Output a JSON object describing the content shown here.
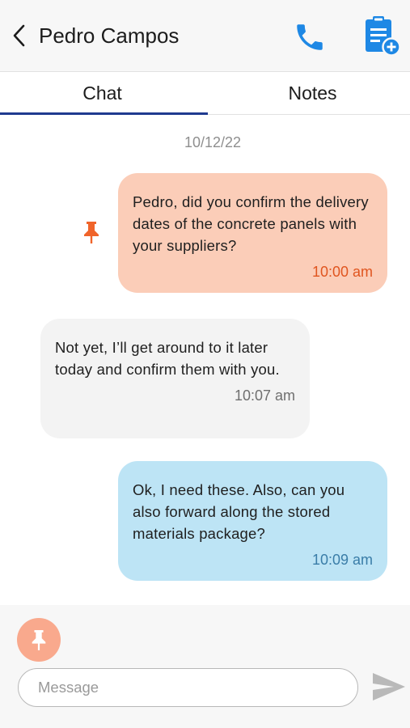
{
  "header": {
    "contact_name": "Pedro Campos",
    "icons": {
      "back": "chevron-left-icon",
      "call": "phone-icon",
      "add_note": "clipboard-add-icon"
    }
  },
  "tabs": [
    {
      "label": "Chat",
      "active": true
    },
    {
      "label": "Notes",
      "active": false
    }
  ],
  "chat": {
    "date": "10/12/22",
    "messages": [
      {
        "direction": "outgoing",
        "pinned": true,
        "text": "Pedro, did you confirm the delivery dates of the concrete panels with your suppliers?",
        "time": "10:00 am"
      },
      {
        "direction": "incoming",
        "pinned": false,
        "text": "Not yet, I’ll get around to it later today and confirm them with you.",
        "time": "10:07 am"
      },
      {
        "direction": "outgoing",
        "pinned": false,
        "text": "Ok, I need these. Also, can you also forward along the stored materials package?",
        "time": "10:09 am"
      }
    ]
  },
  "composer": {
    "placeholder": "Message",
    "value": "",
    "icons": {
      "pin": "pin-icon",
      "send": "send-icon"
    }
  },
  "colors": {
    "accent_blue": "#1e88e5",
    "tab_underline": "#1f3a8f",
    "pinned_bubble": "#fbcdb8",
    "pinned_time": "#e0551f",
    "pin_marker": "#f0642a",
    "incoming_bubble": "#f3f3f3",
    "outgoing_bubble": "#bde4f5",
    "outgoing_time": "#3a7da8",
    "pin_button": "#f9a98d",
    "send_icon": "#b9b9b9"
  }
}
